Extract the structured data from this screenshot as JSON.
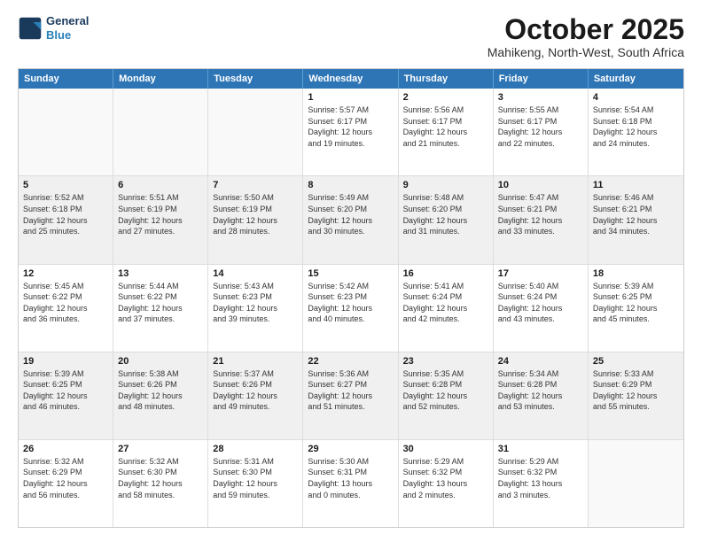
{
  "logo": {
    "line1": "General",
    "line2": "Blue"
  },
  "title": "October 2025",
  "location": "Mahikeng, North-West, South Africa",
  "days_of_week": [
    "Sunday",
    "Monday",
    "Tuesday",
    "Wednesday",
    "Thursday",
    "Friday",
    "Saturday"
  ],
  "weeks": [
    [
      {
        "day": "",
        "empty": true,
        "text": ""
      },
      {
        "day": "",
        "empty": true,
        "text": ""
      },
      {
        "day": "",
        "empty": true,
        "text": ""
      },
      {
        "day": "1",
        "text": "Sunrise: 5:57 AM\nSunset: 6:17 PM\nDaylight: 12 hours\nand 19 minutes."
      },
      {
        "day": "2",
        "text": "Sunrise: 5:56 AM\nSunset: 6:17 PM\nDaylight: 12 hours\nand 21 minutes."
      },
      {
        "day": "3",
        "text": "Sunrise: 5:55 AM\nSunset: 6:17 PM\nDaylight: 12 hours\nand 22 minutes."
      },
      {
        "day": "4",
        "text": "Sunrise: 5:54 AM\nSunset: 6:18 PM\nDaylight: 12 hours\nand 24 minutes."
      }
    ],
    [
      {
        "day": "5",
        "text": "Sunrise: 5:52 AM\nSunset: 6:18 PM\nDaylight: 12 hours\nand 25 minutes.",
        "shaded": true
      },
      {
        "day": "6",
        "text": "Sunrise: 5:51 AM\nSunset: 6:19 PM\nDaylight: 12 hours\nand 27 minutes.",
        "shaded": true
      },
      {
        "day": "7",
        "text": "Sunrise: 5:50 AM\nSunset: 6:19 PM\nDaylight: 12 hours\nand 28 minutes.",
        "shaded": true
      },
      {
        "day": "8",
        "text": "Sunrise: 5:49 AM\nSunset: 6:20 PM\nDaylight: 12 hours\nand 30 minutes.",
        "shaded": true
      },
      {
        "day": "9",
        "text": "Sunrise: 5:48 AM\nSunset: 6:20 PM\nDaylight: 12 hours\nand 31 minutes.",
        "shaded": true
      },
      {
        "day": "10",
        "text": "Sunrise: 5:47 AM\nSunset: 6:21 PM\nDaylight: 12 hours\nand 33 minutes.",
        "shaded": true
      },
      {
        "day": "11",
        "text": "Sunrise: 5:46 AM\nSunset: 6:21 PM\nDaylight: 12 hours\nand 34 minutes.",
        "shaded": true
      }
    ],
    [
      {
        "day": "12",
        "text": "Sunrise: 5:45 AM\nSunset: 6:22 PM\nDaylight: 12 hours\nand 36 minutes."
      },
      {
        "day": "13",
        "text": "Sunrise: 5:44 AM\nSunset: 6:22 PM\nDaylight: 12 hours\nand 37 minutes."
      },
      {
        "day": "14",
        "text": "Sunrise: 5:43 AM\nSunset: 6:23 PM\nDaylight: 12 hours\nand 39 minutes."
      },
      {
        "day": "15",
        "text": "Sunrise: 5:42 AM\nSunset: 6:23 PM\nDaylight: 12 hours\nand 40 minutes."
      },
      {
        "day": "16",
        "text": "Sunrise: 5:41 AM\nSunset: 6:24 PM\nDaylight: 12 hours\nand 42 minutes."
      },
      {
        "day": "17",
        "text": "Sunrise: 5:40 AM\nSunset: 6:24 PM\nDaylight: 12 hours\nand 43 minutes."
      },
      {
        "day": "18",
        "text": "Sunrise: 5:39 AM\nSunset: 6:25 PM\nDaylight: 12 hours\nand 45 minutes."
      }
    ],
    [
      {
        "day": "19",
        "text": "Sunrise: 5:39 AM\nSunset: 6:25 PM\nDaylight: 12 hours\nand 46 minutes.",
        "shaded": true
      },
      {
        "day": "20",
        "text": "Sunrise: 5:38 AM\nSunset: 6:26 PM\nDaylight: 12 hours\nand 48 minutes.",
        "shaded": true
      },
      {
        "day": "21",
        "text": "Sunrise: 5:37 AM\nSunset: 6:26 PM\nDaylight: 12 hours\nand 49 minutes.",
        "shaded": true
      },
      {
        "day": "22",
        "text": "Sunrise: 5:36 AM\nSunset: 6:27 PM\nDaylight: 12 hours\nand 51 minutes.",
        "shaded": true
      },
      {
        "day": "23",
        "text": "Sunrise: 5:35 AM\nSunset: 6:28 PM\nDaylight: 12 hours\nand 52 minutes.",
        "shaded": true
      },
      {
        "day": "24",
        "text": "Sunrise: 5:34 AM\nSunset: 6:28 PM\nDaylight: 12 hours\nand 53 minutes.",
        "shaded": true
      },
      {
        "day": "25",
        "text": "Sunrise: 5:33 AM\nSunset: 6:29 PM\nDaylight: 12 hours\nand 55 minutes.",
        "shaded": true
      }
    ],
    [
      {
        "day": "26",
        "text": "Sunrise: 5:32 AM\nSunset: 6:29 PM\nDaylight: 12 hours\nand 56 minutes."
      },
      {
        "day": "27",
        "text": "Sunrise: 5:32 AM\nSunset: 6:30 PM\nDaylight: 12 hours\nand 58 minutes."
      },
      {
        "day": "28",
        "text": "Sunrise: 5:31 AM\nSunset: 6:30 PM\nDaylight: 12 hours\nand 59 minutes."
      },
      {
        "day": "29",
        "text": "Sunrise: 5:30 AM\nSunset: 6:31 PM\nDaylight: 13 hours\nand 0 minutes."
      },
      {
        "day": "30",
        "text": "Sunrise: 5:29 AM\nSunset: 6:32 PM\nDaylight: 13 hours\nand 2 minutes."
      },
      {
        "day": "31",
        "text": "Sunrise: 5:29 AM\nSunset: 6:32 PM\nDaylight: 13 hours\nand 3 minutes."
      },
      {
        "day": "",
        "empty": true,
        "text": ""
      }
    ]
  ]
}
